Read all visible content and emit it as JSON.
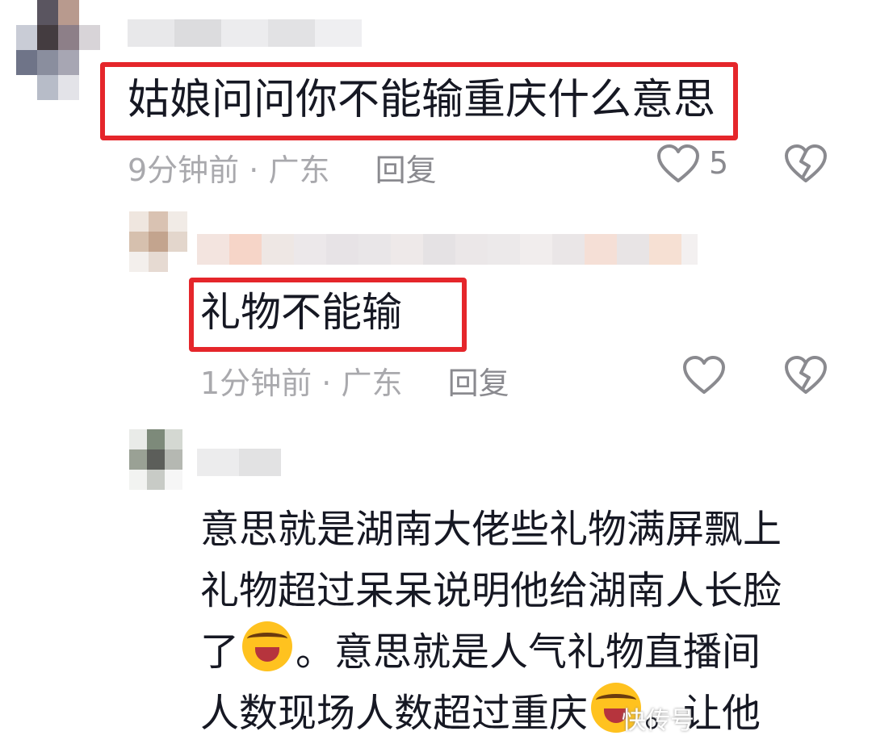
{
  "colors": {
    "highlight": "#e5262b",
    "text": "#161823",
    "meta": "#a9a9ad",
    "icon": "#8a8a8f"
  },
  "comments": [
    {
      "text": "姑娘问问你不能输重庆什么意思",
      "time": "9分钟前",
      "separator": "·",
      "location": "广东",
      "reply_label": "回复",
      "like_count": "5",
      "icons": [
        "heart-outline-icon",
        "broken-heart-icon"
      ]
    },
    {
      "text": "礼物不能输",
      "time": "1分钟前",
      "separator": "·",
      "location": "广东",
      "reply_label": "回复",
      "icons": [
        "heart-outline-icon",
        "broken-heart-icon"
      ]
    },
    {
      "lines": [
        "意思就是湖南大佬些礼物满屏飘上",
        "礼物超过呆呆说明他给湖南人长脸",
        "了",
        "。意思就是人气礼物直播间",
        "人数现场人数超过重庆",
        "。让他"
      ],
      "emoji": "face-with-tears-of-joy-emoji"
    }
  ],
  "watermark": "快传号"
}
